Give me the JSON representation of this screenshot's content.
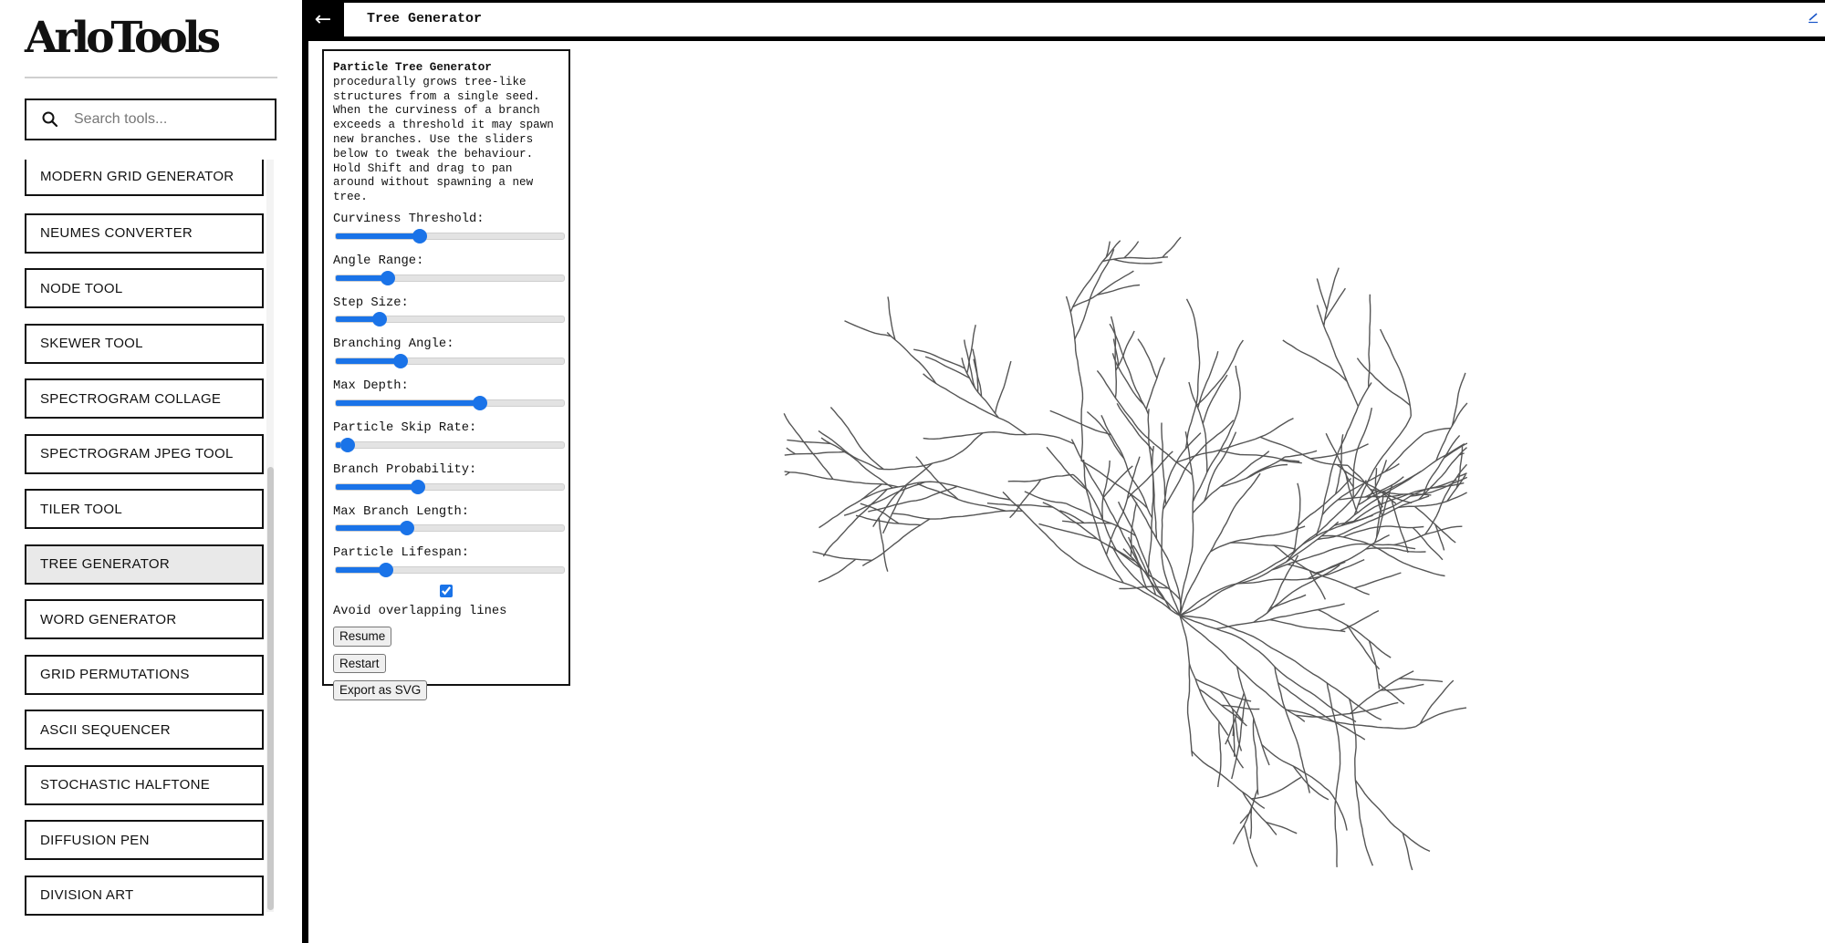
{
  "sidebar": {
    "logo": "ArloTools",
    "search": {
      "placeholder": "Search tools...",
      "value": ""
    },
    "tools": [
      {
        "label": "MODERN GRID GENERATOR",
        "active": false
      },
      {
        "label": "NEUMES CONVERTER",
        "active": false
      },
      {
        "label": "NODE TOOL",
        "active": false
      },
      {
        "label": "SKEWER TOOL",
        "active": false
      },
      {
        "label": "SPECTROGRAM COLLAGE",
        "active": false
      },
      {
        "label": "SPECTROGRAM JPEG TOOL",
        "active": false
      },
      {
        "label": "TILER TOOL",
        "active": false
      },
      {
        "label": "TREE GENERATOR",
        "active": true
      },
      {
        "label": "WORD GENERATOR",
        "active": false
      },
      {
        "label": "GRID PERMUTATIONS",
        "active": false
      },
      {
        "label": "ASCII SEQUENCER",
        "active": false
      },
      {
        "label": "STOCHASTIC HALFTONE",
        "active": false
      },
      {
        "label": "DIFFUSION PEN",
        "active": false
      },
      {
        "label": "DIVISION ART",
        "active": false
      }
    ]
  },
  "header": {
    "back_label": "←",
    "title": "Tree Generator"
  },
  "panel": {
    "title": "Particle Tree Generator",
    "description": "procedurally grows tree-like structures from a single seed. When the curviness of a branch exceeds a threshold it may spawn new branches. Use the sliders below to tweak the behaviour. Hold Shift and drag to pan around without spawning a new tree.",
    "sliders": [
      {
        "label": "Curviness Threshold:",
        "value": 36
      },
      {
        "label": "Angle Range:",
        "value": 21
      },
      {
        "label": "Step Size:",
        "value": 17
      },
      {
        "label": "Branching Angle:",
        "value": 27
      },
      {
        "label": "Max Depth:",
        "value": 64
      },
      {
        "label": "Particle Skip Rate:",
        "value": 2
      },
      {
        "label": "Branch Probability:",
        "value": 35
      },
      {
        "label": "Max Branch Length:",
        "value": 30
      },
      {
        "label": "Particle Lifespan:",
        "value": 20
      }
    ],
    "avoid_overlap": {
      "label": "Avoid overlapping lines",
      "checked": true
    },
    "buttons": {
      "resume": "Resume",
      "restart": "Restart",
      "export": "Export as SVG"
    }
  },
  "colors": {
    "accent": "#1a73e8",
    "active_item": "#e9e9e9",
    "frame": "#000000"
  }
}
